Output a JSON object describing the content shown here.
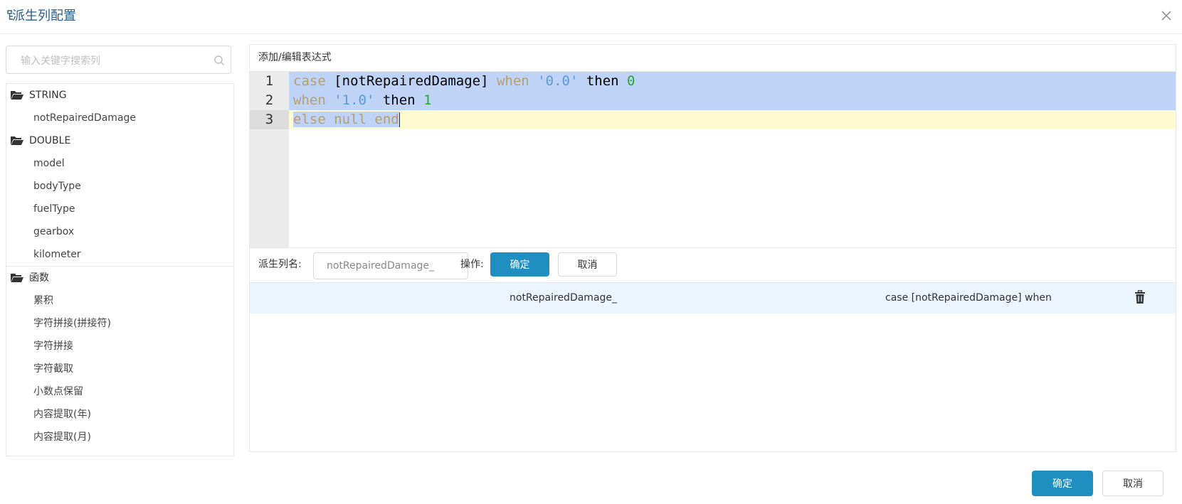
{
  "dialog": {
    "title": "派生列配置"
  },
  "search": {
    "placeholder": "输入关键字搜索列"
  },
  "tree": {
    "groups": [
      {
        "label": "STRING",
        "items": [
          "notRepairedDamage"
        ]
      },
      {
        "label": "DOUBLE",
        "items": [
          "model",
          "bodyType",
          "fuelType",
          "gearbox",
          "kilometer"
        ]
      },
      {
        "label": "函数",
        "items": [
          "累积",
          "字符拼接(拼接符)",
          "字符拼接",
          "字符截取",
          "小数点保留",
          "内容提取(年)",
          "内容提取(月)"
        ]
      }
    ]
  },
  "editor": {
    "title": "添加/编辑表达式",
    "line_numbers": [
      "1",
      "2",
      "3"
    ],
    "tokens": {
      "l1_case": "case",
      "l1_col": " [notRepairedDamage] ",
      "l1_when": "when",
      "l1_sp1": " ",
      "l1_str": "'0.0'",
      "l1_then": " then ",
      "l1_num": "0",
      "l2_when": "when",
      "l2_sp1": " ",
      "l2_str": "'1.0'",
      "l2_then": " then ",
      "l2_num": "1",
      "l3_code": "else null end"
    }
  },
  "form": {
    "name_label": "派生列名:",
    "name_value": "notRepairedDamage_",
    "op_label": "操作:",
    "confirm": "确定",
    "cancel": "取消"
  },
  "results": [
    {
      "name": "notRepairedDamage_",
      "expression": "case [notRepairedDamage] when"
    }
  ],
  "footer": {
    "confirm": "确定",
    "cancel": "取消"
  },
  "colors": {
    "primary": "#1f8fc2",
    "title": "#2a5d8f",
    "selection": "#bfd3f7",
    "active_line": "#fffbd1",
    "row_highlight": "#ecf4fd"
  }
}
